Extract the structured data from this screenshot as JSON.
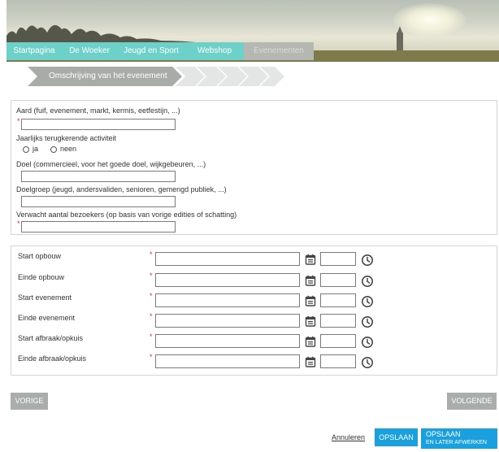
{
  "nav": {
    "items": [
      {
        "label": "Startpagina"
      },
      {
        "label": "De Woeker"
      },
      {
        "label": "Jeugd en Sport"
      },
      {
        "label": "Webshop"
      },
      {
        "label": "Evenementen"
      }
    ]
  },
  "wizard": {
    "current_step": "Omschrijving van het evenement"
  },
  "form": {
    "aard_label": "Aard (fuif, evenement, markt, kermis, eetfestijn, ...)",
    "jaarlijks_label": "Jaarlijks terugkerende activiteit",
    "ja_label": "ja",
    "neen_label": "neen",
    "doel_label": "Doel (commercieel, voor het goede doel, wijkgebeuren, ...)",
    "doelgroep_label": "Doelgroep (jeugd, andersvaliden, senioren, gemengd publiek, ...)",
    "bezoekers_label": "Verwacht aantal bezoekers (op basis van vorige edities of schatting)",
    "required_marker": "*"
  },
  "schedule": {
    "rows": [
      {
        "label": "Start opbouw"
      },
      {
        "label": "Einde opbouw"
      },
      {
        "label": "Start evenement"
      },
      {
        "label": "Einde evenement"
      },
      {
        "label": "Start afbraak/opkuis"
      },
      {
        "label": "Einde afbraak/opkuis"
      }
    ]
  },
  "footer": {
    "previous": "VORIGE",
    "next": "VOLGENDE",
    "cancel": "Annuleren",
    "save": "OPSLAAN",
    "save_later_main": "OPSLAAN",
    "save_later_sub": "EN LATER AFWERKEN"
  },
  "colors": {
    "nav": "#6ed1c9",
    "nav_active": "#b5b8b2",
    "step": "#a8aca9",
    "step_inactive": "#e4e6e5",
    "primary": "#1aa0df",
    "required": "#e03030"
  }
}
